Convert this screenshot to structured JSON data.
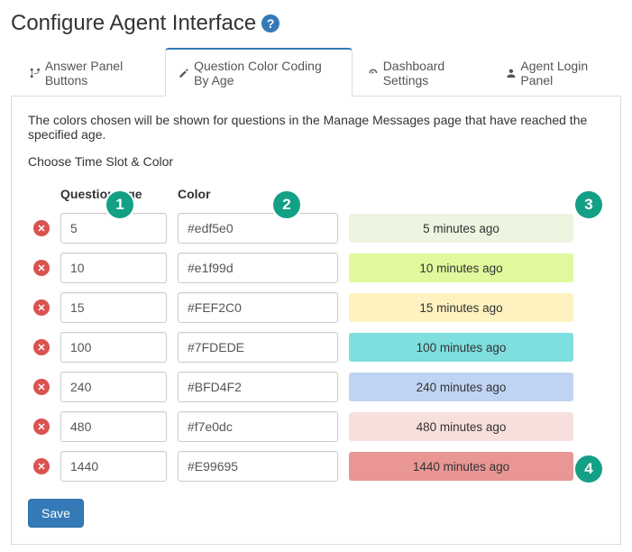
{
  "title": "Configure Agent Interface",
  "tabs": [
    {
      "label": "Answer Panel Buttons",
      "icon": "branch"
    },
    {
      "label": "Question Color Coding By Age",
      "icon": "pencil",
      "active": true
    },
    {
      "label": "Dashboard Settings",
      "icon": "dashboard"
    },
    {
      "label": "Agent Login Panel",
      "icon": "user"
    }
  ],
  "description": "The colors chosen will be shown for questions in the Manage Messages page that have reached the specified age.",
  "subhead": "Choose Time Slot & Color",
  "columns": {
    "age": "Question Age",
    "color": "Color"
  },
  "rows": [
    {
      "age": "5",
      "color": "#edf5e0",
      "preview_label": "5 minutes ago",
      "preview_bg": "#edf5e0"
    },
    {
      "age": "10",
      "color": "#e1f99d",
      "preview_label": "10 minutes ago",
      "preview_bg": "#e1f99d"
    },
    {
      "age": "15",
      "color": "#FEF2C0",
      "preview_label": "15 minutes ago",
      "preview_bg": "#FEF2C0"
    },
    {
      "age": "100",
      "color": "#7FDEDE",
      "preview_label": "100 minutes ago",
      "preview_bg": "#7FDEDE"
    },
    {
      "age": "240",
      "color": "#BFD4F2",
      "preview_label": "240 minutes ago",
      "preview_bg": "#BFD4F2"
    },
    {
      "age": "480",
      "color": "#f7e0dc",
      "preview_label": "480 minutes ago",
      "preview_bg": "#f7e0dc"
    },
    {
      "age": "1440",
      "color": "#E99695",
      "preview_label": "1440 minutes ago",
      "preview_bg": "#E99695"
    }
  ],
  "save_label": "Save",
  "callouts": [
    "1",
    "2",
    "3",
    "4"
  ]
}
